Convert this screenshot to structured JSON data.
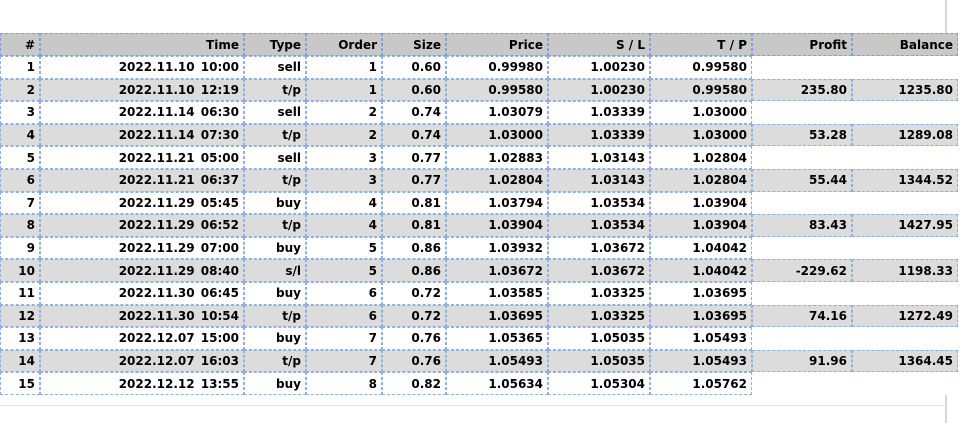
{
  "report": {
    "columns": [
      "#",
      "Time",
      "Type",
      "Order",
      "Size",
      "Price",
      "S / L",
      "T / P",
      "Profit",
      "Balance"
    ],
    "rows": [
      {
        "n": "1",
        "date": "2022.11.10",
        "clock": "10:00",
        "type": "sell",
        "order": "1",
        "size": "0.60",
        "price": "0.99980",
        "sl": "1.00230",
        "tp": "0.99580",
        "profit": "",
        "balance": ""
      },
      {
        "n": "2",
        "date": "2022.11.10",
        "clock": "12:19",
        "type": "t/p",
        "order": "1",
        "size": "0.60",
        "price": "0.99580",
        "sl": "1.00230",
        "tp": "0.99580",
        "profit": "235.80",
        "balance": "1235.80"
      },
      {
        "n": "3",
        "date": "2022.11.14",
        "clock": "06:30",
        "type": "sell",
        "order": "2",
        "size": "0.74",
        "price": "1.03079",
        "sl": "1.03339",
        "tp": "1.03000",
        "profit": "",
        "balance": ""
      },
      {
        "n": "4",
        "date": "2022.11.14",
        "clock": "07:30",
        "type": "t/p",
        "order": "2",
        "size": "0.74",
        "price": "1.03000",
        "sl": "1.03339",
        "tp": "1.03000",
        "profit": "53.28",
        "balance": "1289.08"
      },
      {
        "n": "5",
        "date": "2022.11.21",
        "clock": "05:00",
        "type": "sell",
        "order": "3",
        "size": "0.77",
        "price": "1.02883",
        "sl": "1.03143",
        "tp": "1.02804",
        "profit": "",
        "balance": ""
      },
      {
        "n": "6",
        "date": "2022.11.21",
        "clock": "06:37",
        "type": "t/p",
        "order": "3",
        "size": "0.77",
        "price": "1.02804",
        "sl": "1.03143",
        "tp": "1.02804",
        "profit": "55.44",
        "balance": "1344.52"
      },
      {
        "n": "7",
        "date": "2022.11.29",
        "clock": "05:45",
        "type": "buy",
        "order": "4",
        "size": "0.81",
        "price": "1.03794",
        "sl": "1.03534",
        "tp": "1.03904",
        "profit": "",
        "balance": ""
      },
      {
        "n": "8",
        "date": "2022.11.29",
        "clock": "06:52",
        "type": "t/p",
        "order": "4",
        "size": "0.81",
        "price": "1.03904",
        "sl": "1.03534",
        "tp": "1.03904",
        "profit": "83.43",
        "balance": "1427.95"
      },
      {
        "n": "9",
        "date": "2022.11.29",
        "clock": "07:00",
        "type": "buy",
        "order": "5",
        "size": "0.86",
        "price": "1.03932",
        "sl": "1.03672",
        "tp": "1.04042",
        "profit": "",
        "balance": ""
      },
      {
        "n": "10",
        "date": "2022.11.29",
        "clock": "08:40",
        "type": "s/l",
        "order": "5",
        "size": "0.86",
        "price": "1.03672",
        "sl": "1.03672",
        "tp": "1.04042",
        "profit": "-229.62",
        "balance": "1198.33"
      },
      {
        "n": "11",
        "date": "2022.11.30",
        "clock": "06:45",
        "type": "buy",
        "order": "6",
        "size": "0.72",
        "price": "1.03585",
        "sl": "1.03325",
        "tp": "1.03695",
        "profit": "",
        "balance": ""
      },
      {
        "n": "12",
        "date": "2022.11.30",
        "clock": "10:54",
        "type": "t/p",
        "order": "6",
        "size": "0.72",
        "price": "1.03695",
        "sl": "1.03325",
        "tp": "1.03695",
        "profit": "74.16",
        "balance": "1272.49"
      },
      {
        "n": "13",
        "date": "2022.12.07",
        "clock": "15:00",
        "type": "buy",
        "order": "7",
        "size": "0.76",
        "price": "1.05365",
        "sl": "1.05035",
        "tp": "1.05493",
        "profit": "",
        "balance": ""
      },
      {
        "n": "14",
        "date": "2022.12.07",
        "clock": "16:03",
        "type": "t/p",
        "order": "7",
        "size": "0.76",
        "price": "1.05493",
        "sl": "1.05035",
        "tp": "1.05493",
        "profit": "91.96",
        "balance": "1364.45"
      },
      {
        "n": "15",
        "date": "2022.12.12",
        "clock": "13:55",
        "type": "buy",
        "order": "8",
        "size": "0.82",
        "price": "1.05634",
        "sl": "1.05304",
        "tp": "1.05762",
        "profit": "",
        "balance": ""
      }
    ]
  },
  "colors": {
    "header_bg": "#c8c8c8",
    "shade_row_bg": "#dcdcdc",
    "plain_row_bg": "#ffffff",
    "grid_border": "#8fb0e0"
  }
}
